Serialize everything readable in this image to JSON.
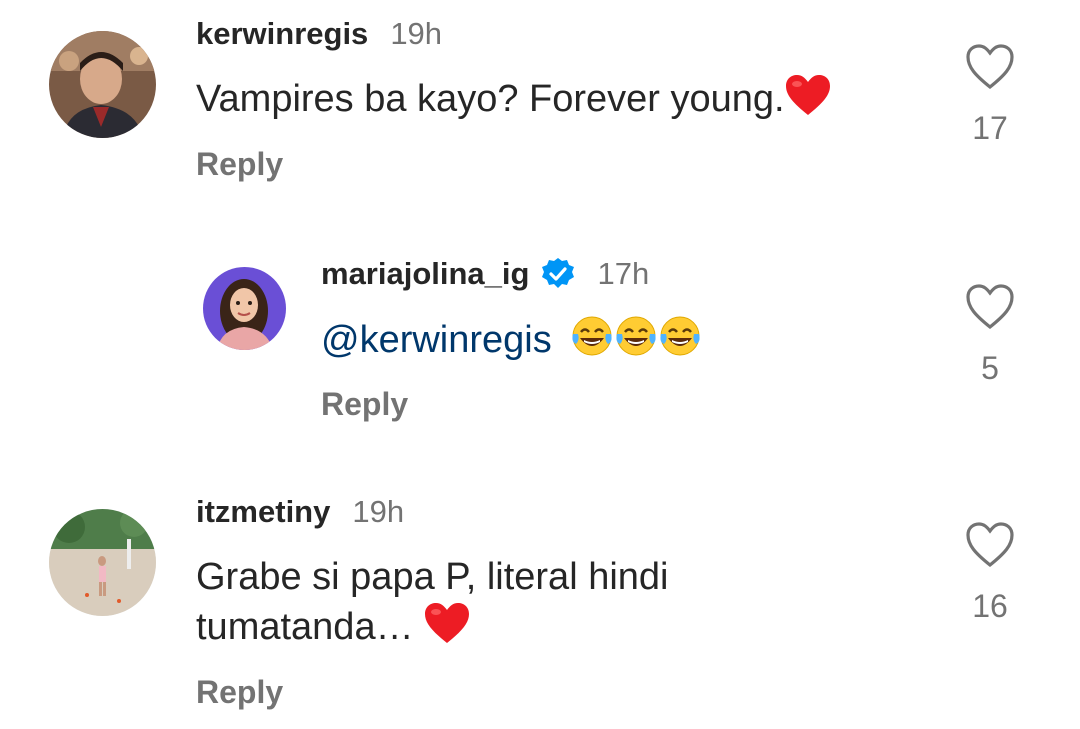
{
  "comments": [
    {
      "username": "kerwinregis",
      "time": "19h",
      "text": "Vampires ba kayo? Forever young.",
      "likes": "17",
      "reply_label": "Reply",
      "avatar_icon": "profile-photo-man-suit"
    },
    {
      "username": "mariajolina_ig",
      "verified": true,
      "time": "17h",
      "mention": "@kerwinregis",
      "likes": "5",
      "reply_label": "Reply",
      "avatar_icon": "profile-photo-woman-purple"
    },
    {
      "username": "itzmetiny",
      "time": "19h",
      "text_line1": "Grabe si papa P, literal hindi",
      "text_line2": "tumatanda…",
      "likes": "16",
      "reply_label": "Reply",
      "avatar_icon": "profile-photo-beach-scene"
    }
  ],
  "colors": {
    "text_primary": "#262626",
    "text_secondary": "#737373",
    "mention": "#00376b",
    "verified_blue": "#0095f6",
    "heart_red": "#ed1c24"
  }
}
